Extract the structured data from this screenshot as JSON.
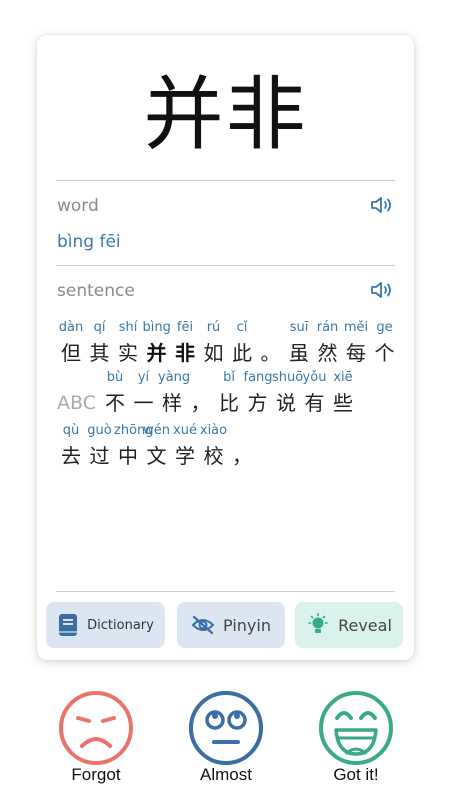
{
  "card": {
    "headword": "并非",
    "word_label": "word",
    "word_pinyin": "bìng fēi",
    "sentence_label": "sentence",
    "sentence_lines": [
      {
        "tokens": [
          {
            "py": "dàn",
            "h": "但"
          },
          {
            "py": "qí",
            "h": "其"
          },
          {
            "py": "shí",
            "h": "实"
          },
          {
            "py": "bìng",
            "h": "并",
            "bold": true
          },
          {
            "py": "fēi",
            "h": "非",
            "bold": true
          },
          {
            "py": "rú",
            "h": "如"
          },
          {
            "py": "cǐ",
            "h": "此"
          },
          {
            "py": "",
            "h": "。"
          },
          {
            "py": "suī",
            "h": "虽"
          },
          {
            "py": "rán",
            "h": "然"
          },
          {
            "py": "měi",
            "h": "每"
          },
          {
            "py": "ge",
            "h": "个"
          }
        ]
      },
      {
        "prefix": "ABC",
        "tokens": [
          {
            "py": "bù",
            "h": "不"
          },
          {
            "py": "yí",
            "h": "一"
          },
          {
            "py": "yàng",
            "h": "样"
          },
          {
            "py": "",
            "h": "，"
          },
          {
            "py": "bǐ",
            "h": "比"
          },
          {
            "py": "fang",
            "h": "方"
          },
          {
            "py": "shuō",
            "h": "说"
          },
          {
            "py": "yǒu",
            "h": "有"
          },
          {
            "py": "xiē",
            "h": "些"
          }
        ]
      },
      {
        "tokens": [
          {
            "py": "qù",
            "h": "去"
          },
          {
            "py": "guò",
            "h": "过"
          },
          {
            "py": "zhōng",
            "h": "中"
          },
          {
            "py": "wén",
            "h": "文"
          },
          {
            "py": "xué",
            "h": "学"
          },
          {
            "py": "xiào",
            "h": "校"
          },
          {
            "py": "",
            "h": "，"
          }
        ]
      }
    ]
  },
  "toolbar": {
    "dictionary_label": "Dictionary",
    "pinyin_label": "Pinyin",
    "reveal_label": "Reveal"
  },
  "ratings": {
    "forgot_label": "Forgot",
    "almost_label": "Almost",
    "gotit_label": "Got it!"
  },
  "colors": {
    "accent_blue": "#3a78a8",
    "forgot": "#e8746a",
    "almost": "#3b6ea5",
    "gotit": "#3aa88a"
  },
  "icons": {
    "speaker": "speaker-icon",
    "dictionary": "book-icon",
    "pinyin": "eye-off-icon",
    "reveal": "lightbulb-icon"
  }
}
